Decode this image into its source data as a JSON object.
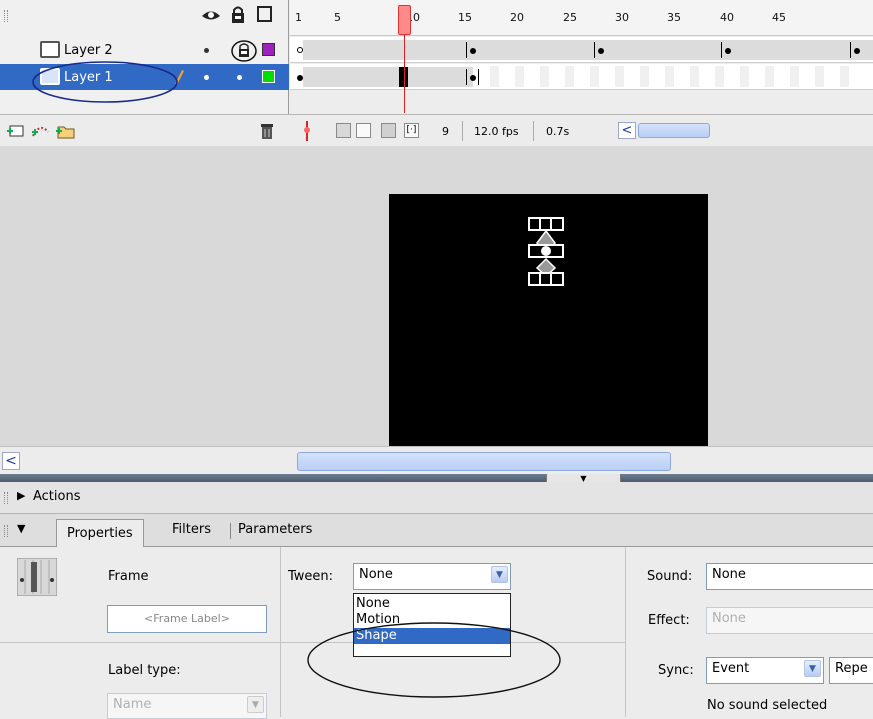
{
  "timeline": {
    "ruler_numbers": [
      "1",
      "5",
      "10",
      "15",
      "20",
      "25",
      "30",
      "35",
      "40",
      "45"
    ],
    "layers": [
      {
        "name": "Layer 2",
        "color": "#a020c0",
        "selected": false
      },
      {
        "name": "Layer 1",
        "color": "#00e000",
        "selected": true
      }
    ],
    "footer": {
      "current_frame": "9",
      "frame_rate": "12.0 fps",
      "elapsed_time": "0.7s"
    }
  },
  "panels": {
    "actions_label": "Actions",
    "tabs": [
      "Properties",
      "Filters",
      "Parameters"
    ]
  },
  "properties": {
    "frame_heading": "Frame",
    "frame_label_placeholder": "<Frame Label>",
    "label_type_heading": "Label type:",
    "label_type_value": "Name",
    "tween_label": "Tween:",
    "tween_value": "None",
    "tween_options": [
      "None",
      "Motion",
      "Shape"
    ],
    "tween_highlighted": "Shape",
    "sound_label": "Sound:",
    "sound_value": "None",
    "effect_label": "Effect:",
    "effect_value": "None",
    "sync_label": "Sync:",
    "sync_value": "Event",
    "repeat_value": "Repe",
    "sound_status": "No sound selected"
  },
  "colors": {
    "selection": "#316ac5",
    "playhead": "#ff8a8a",
    "stage": "#000000",
    "annotation_ellipse": "#1a2a8a"
  }
}
